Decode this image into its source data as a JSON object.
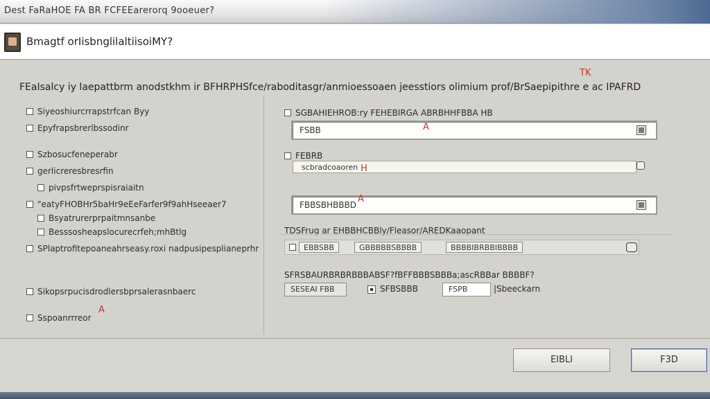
{
  "window": {
    "title": "Dest FaRaHOE FA BR FCFEEarerorq 9ooeuer?"
  },
  "header": {
    "heading": "Bmagtf orIisbnglilaltiisoiMY?"
  },
  "main": {
    "instructions": "FEaIsalcy iy laepattbrm anodstkhm ir BFHRPHSfce/raboditasgr/anmioessoaen jeesstiors olimium prof/BrSaepipithre e ac IPAFRD"
  },
  "left_options": [
    {
      "label": "Siyeoshiurcrrapstrfcan Byy"
    },
    {
      "label": "Epyfrapsbrerlbssodinr"
    },
    {
      "label": "Szbosucfeneperabr"
    },
    {
      "label": "gerlicreresbresrfin"
    },
    {
      "label": "pivpsfrtweprspisraiaitn"
    },
    {
      "label": "\"eatyFHOBHr5baHr9eEeFarfer9f9ahHseeaer7"
    },
    {
      "label": "Bsyatrurerprpaitmnsanbe"
    },
    {
      "label": "Besssosheapslocurecrfeh;mhBtlg"
    },
    {
      "label": "SPlaptrofitepoaneahrseasy.roxi nadpusipesplianeprhr"
    },
    {
      "label": "Sikopsrpucisdrodlersbprsalerasnbaerc"
    },
    {
      "label": "Sspoanrrreor"
    }
  ],
  "right_fields": {
    "field1": {
      "label": "SGBAHIEHROB:ry FEHEBIRGA ABRBHHFBBA HB",
      "value": "FSBB"
    },
    "field2": {
      "label": "FEBRB",
      "value": "scbradcoaoren"
    },
    "field3": {
      "value": "FBBSBHBBBD"
    },
    "description": "TDSFrug ar EHBBHCBBly/Fleasor/AREDKaaopant",
    "segments": [
      "EBBSBB",
      "GBBBBBSBBBB",
      "BBBBIBRBBIBBBB"
    ],
    "line2": "SFRSBAURBRBRBBBABSF?fBFFBBBSBBBa;ascRBBar BBBBF?",
    "pair_left": "SESEAI FBB",
    "pair_mid": "SFBSBBB",
    "pair_right": "FSPB",
    "pair_suffix": "|Sbeeckarn"
  },
  "footer": {
    "back_label": "EIBLI",
    "next_label": "F3D"
  },
  "annotations": [
    "TK",
    "A",
    "H",
    "A",
    "A"
  ],
  "colors": {
    "accent": "#4d6a93",
    "annotation": "#c0392b"
  }
}
